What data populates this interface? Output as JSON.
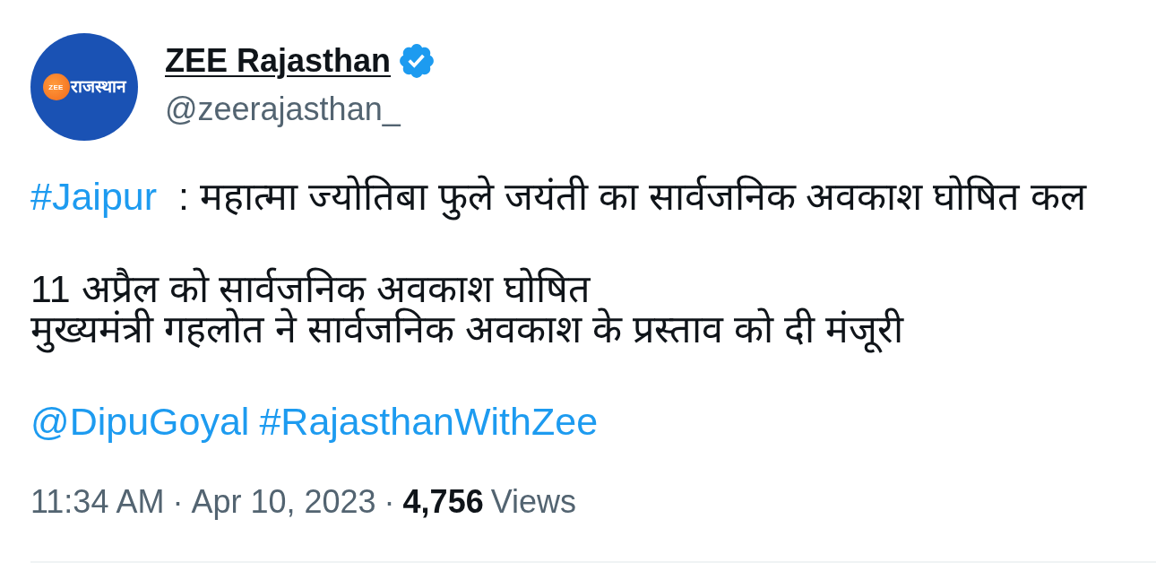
{
  "author": {
    "avatar": {
      "badge_text": "ZEE",
      "wordmark": "राजस्थान"
    },
    "name": "ZEE Rajasthan",
    "verified": true,
    "handle": "@zeerajasthan_"
  },
  "body": [
    {
      "lines": [
        {
          "segments": [
            {
              "kind": "hashtag",
              "text": "#Jaipur"
            },
            {
              "kind": "text",
              "text": "  : महात्मा ज्योतिबा फुले जयंती का सार्वजनिक अवकाश घोषित कल"
            }
          ]
        }
      ]
    },
    {
      "lines": [
        {
          "segments": [
            {
              "kind": "text",
              "text": "11 अप्रैल को सार्वजनिक अवकाश घोषित"
            }
          ]
        },
        {
          "segments": [
            {
              "kind": "text",
              "text": "मुख्यमंत्री गहलोत ने सार्वजनिक अवकाश के प्रस्ताव को दी मंजूरी"
            }
          ]
        }
      ]
    },
    {
      "lines": [
        {
          "segments": [
            {
              "kind": "mention",
              "text": "@DipuGoyal"
            },
            {
              "kind": "hashtag",
              "text": "#RajasthanWithZee"
            }
          ]
        }
      ]
    }
  ],
  "meta": [
    {
      "kind": "time",
      "text": "11:34 AM"
    },
    {
      "kind": "separator",
      "text": "·"
    },
    {
      "kind": "date",
      "text": "Apr 10, 2023"
    },
    {
      "kind": "separator",
      "text": "·"
    },
    {
      "kind": "count",
      "text": "4,756"
    },
    {
      "kind": "label",
      "text": "Views"
    }
  ]
}
